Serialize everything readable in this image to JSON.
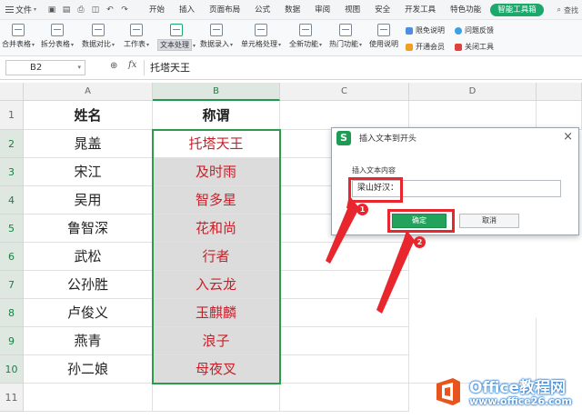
{
  "menubar": {
    "file_label": "文件",
    "tabs": [
      "开始",
      "插入",
      "页面布局",
      "公式",
      "数据",
      "审阅",
      "视图",
      "安全",
      "开发工具",
      "特色功能",
      "智能工具箱"
    ],
    "active_tab_index": 10,
    "right_text": "查找",
    "active_color": "#1aa86b"
  },
  "ribbon": {
    "items": [
      "合并表格",
      "拆分表格",
      "数据对比",
      "工作表",
      "文本处理",
      "数据录入",
      "单元格处理",
      "全新功能",
      "热门功能",
      "使用说明"
    ],
    "active_index": 4,
    "side_items": [
      "限免说明",
      "问题反馈",
      "开通会员",
      "关闭工具"
    ]
  },
  "formula_bar": {
    "cell_ref": "B2",
    "fx": "fx",
    "content": "托塔天王"
  },
  "sheet": {
    "columns": [
      "A",
      "B",
      "C",
      "D"
    ],
    "rows": [
      "1",
      "2",
      "3",
      "4",
      "5",
      "6",
      "7",
      "8",
      "9",
      "10",
      "11"
    ],
    "header": {
      "name": "姓名",
      "title": "称谓"
    },
    "data": [
      {
        "name": "晁盖",
        "title": "托塔天王"
      },
      {
        "name": "宋江",
        "title": "及时雨"
      },
      {
        "name": "吴用",
        "title": "智多星"
      },
      {
        "name": "鲁智深",
        "title": "花和尚"
      },
      {
        "name": "武松",
        "title": "行者"
      },
      {
        "name": "公孙胜",
        "title": "入云龙"
      },
      {
        "name": "卢俊义",
        "title": "玉麒麟"
      },
      {
        "name": "燕青",
        "title": "浪子"
      },
      {
        "name": "孙二娘",
        "title": "母夜叉"
      }
    ],
    "selected_range": "B2:B10",
    "title_color": "#c8202a"
  },
  "dialog": {
    "logo": "S",
    "title": "插入文本到开头",
    "label": "插入文本内容",
    "input_value": "梁山好汉：",
    "ok_label": "确定",
    "cancel_label": "取消"
  },
  "annotations": {
    "badge1": "1",
    "badge2": "2",
    "color": "#e8262d"
  },
  "watermark": {
    "title": "Office教程网",
    "url": "www.office26.com"
  }
}
